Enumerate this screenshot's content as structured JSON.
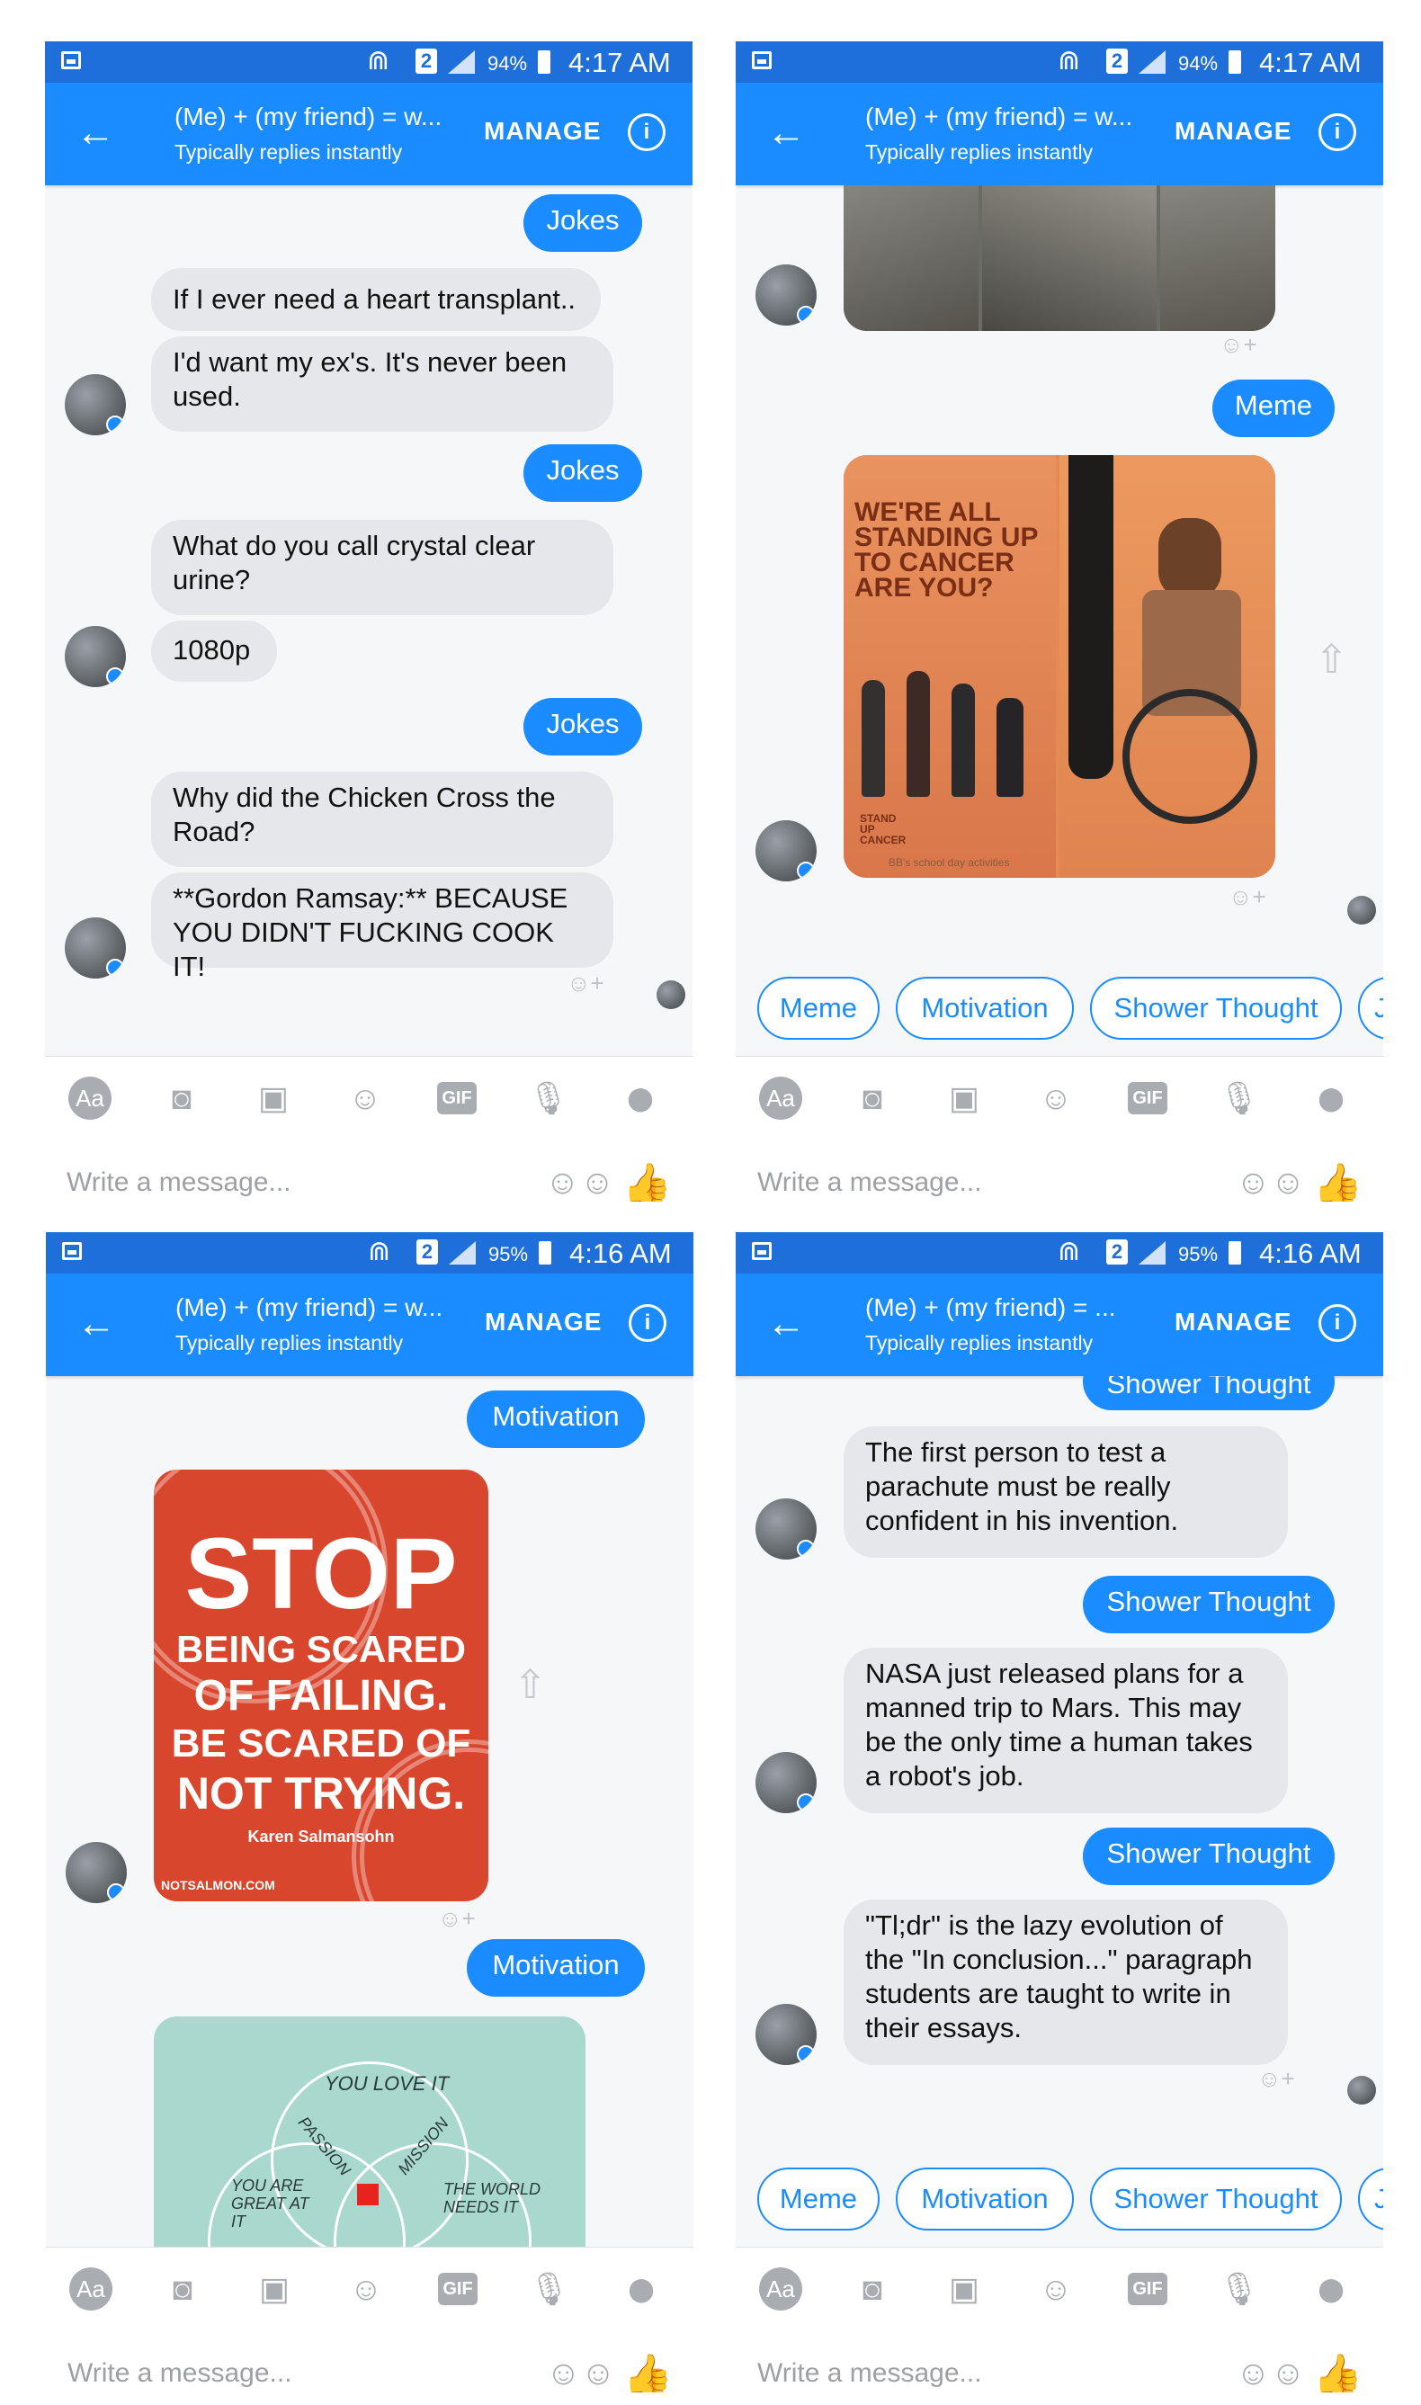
{
  "screens": [
    {
      "status": {
        "wifi": "⋒",
        "sim": "2",
        "battery": "94%",
        "time": "4:17 AM"
      },
      "header": {
        "back_icon": "←",
        "title": "(Me) + (my friend) = w...",
        "subtitle": "Typically replies instantly",
        "manage": "MANAGE",
        "info_icon": "i"
      },
      "messages": {
        "m1": "Jokes",
        "m2": "If I ever need a heart transplant..",
        "m3": "I'd want my ex's. It's never been used.",
        "m4": "Jokes",
        "m5": "What do you call crystal clear urine?",
        "m6": "1080p",
        "m7": "Jokes",
        "m8": "Why did the Chicken Cross the Road?",
        "m9": "**Gordon Ramsay:** BECAUSE YOU DIDN'T FUCKING COOK IT!"
      }
    },
    {
      "status": {
        "wifi": "⋒",
        "sim": "2",
        "battery": "94%",
        "time": "4:17 AM"
      },
      "header": {
        "back_icon": "←",
        "title": "(Me) + (my friend) = w...",
        "subtitle": "Typically replies instantly",
        "manage": "MANAGE",
        "info_icon": "i"
      },
      "messages": {
        "m1": "Meme",
        "poster_text": "WE'RE ALL STANDING UP TO CANCER ARE YOU?",
        "poster_small": "STAND UP CANCER",
        "caption": "BB's school day activities"
      },
      "quick_replies": [
        "Meme",
        "Motivation",
        "Shower Thought",
        "J"
      ]
    },
    {
      "status": {
        "wifi": "⋒",
        "sim": "2",
        "battery": "95%",
        "time": "4:16 AM"
      },
      "header": {
        "back_icon": "←",
        "title": "(Me) + (my friend) = w...",
        "subtitle": "Typically replies instantly",
        "manage": "MANAGE",
        "info_icon": "i"
      },
      "messages": {
        "m1": "Motivation",
        "poster_l1": "STOP",
        "poster_l2": "BEING SCARED",
        "poster_l3": "OF FAILING.",
        "poster_l4": "BE SCARED OF",
        "poster_l5": "NOT TRYING.",
        "poster_author": "Karen Salmansohn",
        "poster_site": "NOTSALMON.COM",
        "m2": "Motivation",
        "venn_1": "YOU LOVE IT",
        "venn_2": "PASSION",
        "venn_3": "MISSION",
        "venn_4": "YOU ARE GREAT AT IT",
        "venn_5": "THE WORLD NEEDS IT"
      }
    },
    {
      "status": {
        "wifi": "⋒",
        "sim": "2",
        "battery": "95%",
        "time": "4:16 AM"
      },
      "header": {
        "back_icon": "←",
        "title": "(Me) + (my friend) = ...",
        "subtitle": "Typically replies instantly",
        "manage": "MANAGE",
        "info_icon": "i"
      },
      "messages": {
        "m0": "Shower Thought",
        "m1": "The first person to test a parachute must be really confident in his invention.",
        "m2": "Shower Thought",
        "m3": "NASA just released plans for a manned trip to Mars. This may be the only time a human takes a robot's job.",
        "m4": "Shower Thought",
        "m5": "\"Tl;dr\" is the lazy evolution of the \"In conclusion...\" paragraph students are taught to write in their essays."
      },
      "quick_replies": [
        "Meme",
        "Motivation",
        "Shower Thought",
        "J"
      ]
    }
  ],
  "toolbar": {
    "aa": "Aa",
    "camera": "◙",
    "gallery": "▣",
    "smile": "☺",
    "gif": "GIF",
    "mic": "🎙",
    "location": "⬤"
  },
  "composer": {
    "placeholder": "Write a message...",
    "emoji": "☺☺",
    "like": "👍"
  },
  "reaction_icon": "☺+",
  "share_icon": "⇧",
  "colors": {
    "brand": "#1a8cff",
    "status": "#1e6fd9",
    "received": "#e6e7eb",
    "background": "#f6f7f9"
  }
}
